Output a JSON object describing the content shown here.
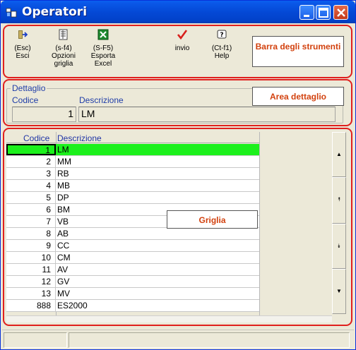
{
  "window": {
    "title": "Operatori"
  },
  "toolbar": {
    "items": [
      {
        "label": "(Esc)\nEsci",
        "icon": "exit-icon"
      },
      {
        "label": "(s-f4)\nOpzioni\ngriglia",
        "icon": "grid-options-icon"
      },
      {
        "label": "(S-F5)\nEsporta\nExcel",
        "icon": "excel-icon"
      },
      {
        "label": "invio",
        "icon": "checkmark-icon"
      },
      {
        "label": "(Ct-f1)\nHelp",
        "icon": "help-icon"
      }
    ],
    "callout": "Barra degli strumenti"
  },
  "detail": {
    "legend": "Dettaglio",
    "code_label": "Codice",
    "desc_label": "Descrizione",
    "code_value": "1",
    "desc_value": "LM",
    "callout": "Area dettaglio"
  },
  "grid": {
    "columns": [
      "Codice",
      "Descrizione"
    ],
    "rows": [
      {
        "code": "1",
        "desc": "LM"
      },
      {
        "code": "2",
        "desc": "MM"
      },
      {
        "code": "3",
        "desc": "RB"
      },
      {
        "code": "4",
        "desc": "MB"
      },
      {
        "code": "5",
        "desc": "DP"
      },
      {
        "code": "6",
        "desc": "BM"
      },
      {
        "code": "7",
        "desc": "VB"
      },
      {
        "code": "8",
        "desc": "AB"
      },
      {
        "code": "9",
        "desc": "CC"
      },
      {
        "code": "10",
        "desc": "CM"
      },
      {
        "code": "11",
        "desc": "AV"
      },
      {
        "code": "12",
        "desc": "GV"
      },
      {
        "code": "13",
        "desc": "MV"
      },
      {
        "code": "888",
        "desc": "ES2000"
      }
    ],
    "selected_row": 0,
    "callout": "Griglia"
  },
  "colors": {
    "highlight": "#e0201e",
    "selection": "#1cf01c",
    "callout_text": "#d2410e"
  }
}
